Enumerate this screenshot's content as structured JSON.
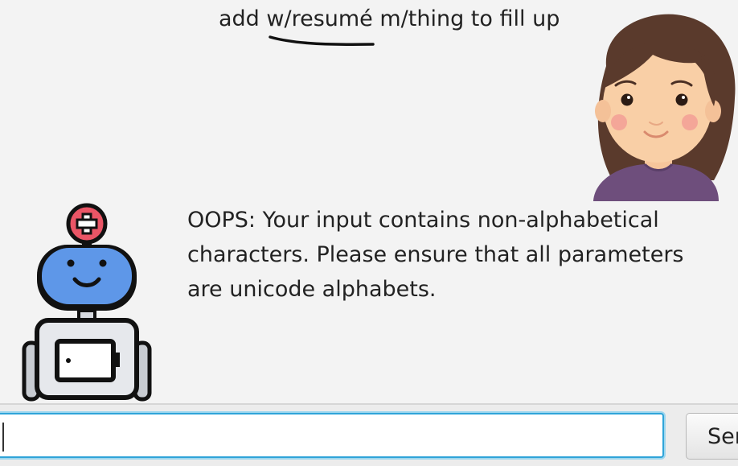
{
  "conversation": {
    "user_message": "add w/resumé m/thing to fill up",
    "bot_message": " OOPS: Your input contains non-alphabetical characters. Please ensure that all parameters are unicode alphabets."
  },
  "input": {
    "value": "",
    "placeholder": ""
  },
  "send_button": {
    "label": "Send"
  },
  "icons": {
    "user_avatar": "woman-avatar-icon",
    "bot_avatar": "medical-robot-avatar-icon"
  },
  "colors": {
    "input_focus_border": "#2fa4d9",
    "robot_head": "#5e97e8",
    "robot_cross": "#ea5566",
    "hair": "#5a3a2c",
    "shirt": "#6e4e7c"
  }
}
